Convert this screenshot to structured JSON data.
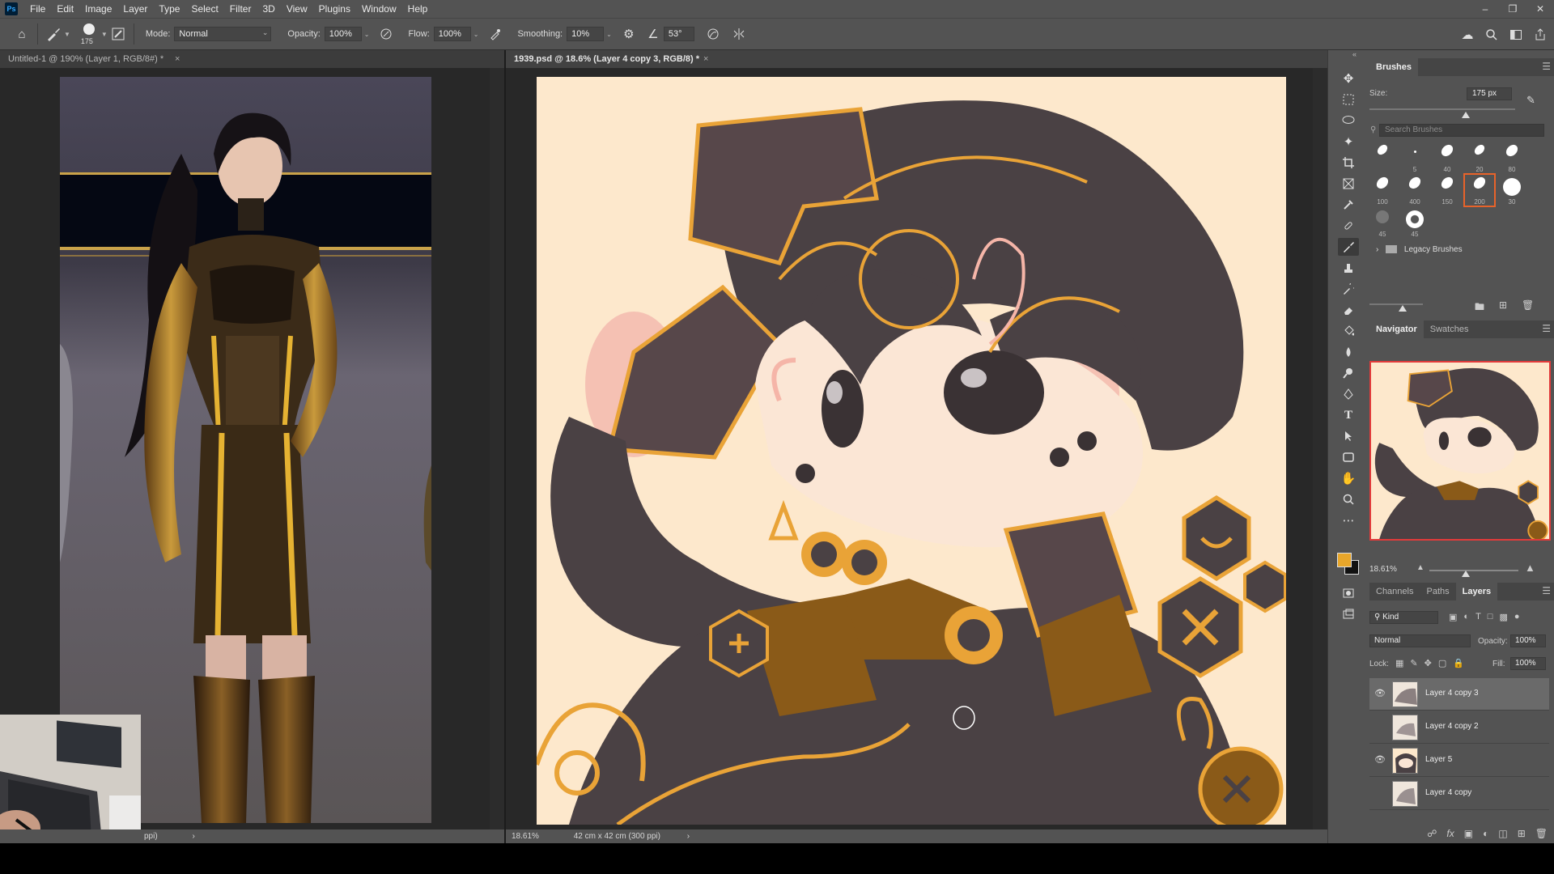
{
  "app": {
    "logo": "Ps"
  },
  "menu": [
    "File",
    "Edit",
    "Image",
    "Layer",
    "Type",
    "Select",
    "Filter",
    "3D",
    "View",
    "Plugins",
    "Window",
    "Help"
  ],
  "options": {
    "brush_size": "175",
    "mode_label": "Mode:",
    "mode_value": "Normal",
    "opacity_label": "Opacity:",
    "opacity_value": "100%",
    "flow_label": "Flow:",
    "flow_value": "100%",
    "smoothing_label": "Smoothing:",
    "smoothing_value": "10%",
    "angle_value": "53°"
  },
  "tabs": {
    "doc1": "Untitled-1 @ 190% (Layer 1, RGB/8#) *",
    "doc2": "1939.psd @ 18.6% (Layer 4 copy 3, RGB/8) *",
    "close": "×"
  },
  "status": {
    "doc1_text": "ppi)",
    "doc1_arrow": "›",
    "doc2_zoom": "18.61%",
    "doc2_size": "42 cm x 42 cm (300 ppi)",
    "doc2_arrow": "›"
  },
  "brushes_panel": {
    "tab": "Brushes",
    "size_label": "Size:",
    "size_value": "175 px",
    "search_placeholder": "Search Brushes",
    "tips": [
      "",
      "5",
      "40",
      "20",
      "80",
      "100",
      "400",
      "150",
      "200",
      "30",
      "45",
      "45"
    ],
    "legacy_folder": "Legacy Brushes"
  },
  "navigator_panel": {
    "tabs": [
      "Navigator",
      "Swatches"
    ],
    "zoom": "18.61%"
  },
  "layers_panel": {
    "tabs": [
      "Channels",
      "Paths",
      "Layers"
    ],
    "kind_filter": "Kind",
    "blend_mode": "Normal",
    "opacity_label": "Opacity:",
    "opacity_value": "100%",
    "lock_label": "Lock:",
    "fill_label": "Fill:",
    "fill_value": "100%",
    "layers": [
      {
        "name": "Layer 4 copy 3",
        "visible": true,
        "selected": true
      },
      {
        "name": "Layer 4 copy 2",
        "visible": false,
        "selected": false
      },
      {
        "name": "Layer 5",
        "visible": true,
        "selected": false
      },
      {
        "name": "Layer 4 copy",
        "visible": false,
        "selected": false
      }
    ]
  },
  "colors": {
    "foreground": "#e8a62a",
    "background": "#111111",
    "ui_panel": "#535353",
    "workspace": "#282828",
    "canvas_paper": "#fde8cc",
    "selection_accent": "#e8632a"
  },
  "icons": {
    "tools": [
      "move-icon",
      "marquee-icon",
      "lasso-icon",
      "magic-wand-icon",
      "crop-icon",
      "frame-icon",
      "eyedropper-icon",
      "healing-icon",
      "brush-icon",
      "stamp-icon",
      "history-brush-icon",
      "eraser-icon",
      "bucket-icon",
      "blur-icon",
      "dodge-icon",
      "pen-icon",
      "type-icon",
      "path-select-icon",
      "shape-icon",
      "hand-icon",
      "zoom-icon",
      "more-icon"
    ]
  }
}
